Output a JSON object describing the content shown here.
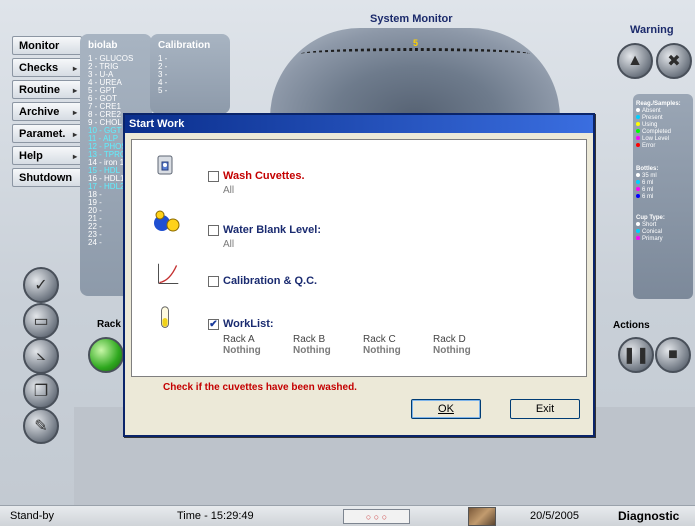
{
  "header": {
    "system_monitor": "System Monitor",
    "warning": "Warning",
    "carousel_number": "5"
  },
  "nav": [
    {
      "label": "Monitor",
      "arrow": ""
    },
    {
      "label": "Checks",
      "arrow": "▸"
    },
    {
      "label": "Routine",
      "arrow": "▸"
    },
    {
      "label": "Archive",
      "arrow": "▸"
    },
    {
      "label": "Paramet.",
      "arrow": "▸"
    },
    {
      "label": "Help",
      "arrow": "▸"
    },
    {
      "label": "Shutdown",
      "arrow": ""
    }
  ],
  "biolab": {
    "title": "biolab",
    "items": [
      "1 - GLUCOS",
      "2 - TRIG",
      "3 - U-A",
      "4 - UREA",
      "5 - GPT",
      "6 - GOT",
      "7 - CRE1",
      "8 - CRE2",
      "9 - CHOL",
      "10 - GGT",
      "11 - ALP",
      "12 - PHOS",
      "13 - TPRO",
      "14 - iron 1",
      "15 - HDL",
      "16 - HDL1",
      "17 - HDL2",
      "18 -",
      "19 -",
      "20 -",
      "21 -",
      "22 -",
      "23 -",
      "24 -"
    ],
    "cyan": [
      9,
      10,
      11,
      12,
      14,
      16
    ]
  },
  "calibration": {
    "title": "Calibration",
    "items": [
      "1 -",
      "2 -",
      "3 -",
      "4 -",
      "5 -"
    ]
  },
  "labels": {
    "rack": "Rack",
    "actions": "Actions"
  },
  "legend": {
    "reag_title": "Reag./Samples:",
    "reag": [
      {
        "text": "Absent",
        "color": "#ffffff"
      },
      {
        "text": "Present",
        "color": "#00d0ff"
      },
      {
        "text": "Using",
        "color": "#ffff00"
      },
      {
        "text": "Completed",
        "color": "#00ff00"
      },
      {
        "text": "Low Level",
        "color": "#ff00ff"
      },
      {
        "text": "Error",
        "color": "#ff0000"
      }
    ],
    "bottles_title": "Bottles:",
    "bottles": [
      {
        "text": "35 ml",
        "color": "#ffffff"
      },
      {
        "text": "6 ml",
        "color": "#00d0ff"
      },
      {
        "text": "6 ml",
        "color": "#ff00ff"
      },
      {
        "text": "6 ml",
        "color": "#0000ff"
      }
    ],
    "cup_title": "Cup Type:",
    "cups": [
      {
        "text": "Short",
        "color": "#ffffff"
      },
      {
        "text": "Conical",
        "color": "#00d0ff"
      },
      {
        "text": "Primary",
        "color": "#ff00ff"
      }
    ]
  },
  "dialog": {
    "title": "Start Work",
    "wash": {
      "label": "Wash Cuvettes.",
      "sub": "All",
      "checked": false
    },
    "water": {
      "label": "Water Blank Level:",
      "sub": "All",
      "checked": false
    },
    "calib": {
      "label": "Calibration & Q.C.",
      "checked": false
    },
    "worklist": {
      "label": "WorkList:",
      "checked": true
    },
    "racks": [
      {
        "name": "Rack A",
        "value": "Nothing"
      },
      {
        "name": "Rack B",
        "value": "Nothing"
      },
      {
        "name": "Rack C",
        "value": "Nothing"
      },
      {
        "name": "Rack D",
        "value": "Nothing"
      }
    ],
    "message": "Check if the cuvettes have been washed.",
    "ok": "OK",
    "exit": "Exit"
  },
  "status": {
    "state": "Stand-by",
    "time": "Time - 15:29:49",
    "lights": "○ ○ ○",
    "date": "20/5/2005",
    "mode": "Diagnostic"
  }
}
